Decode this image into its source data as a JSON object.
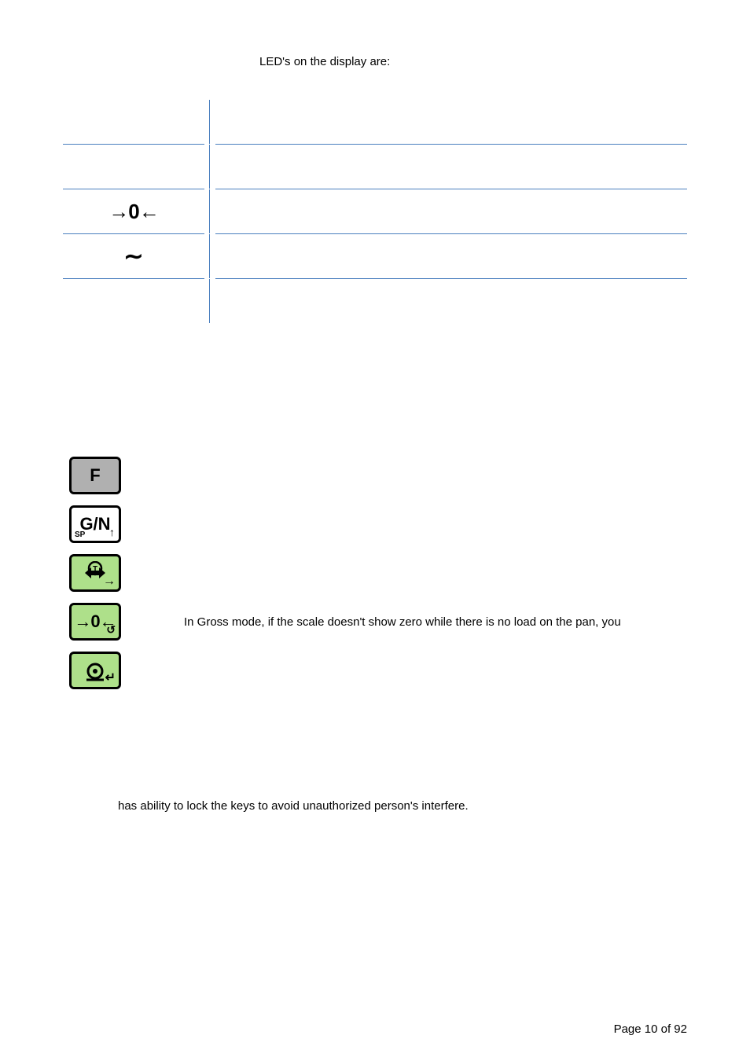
{
  "intro_text": "LED's on the display are:",
  "table": {
    "rows": [
      {
        "symbol_name": "blank-1",
        "symbol_glyph": ""
      },
      {
        "symbol_name": "blank-2",
        "symbol_glyph": ""
      },
      {
        "symbol_name": "zero-indicator",
        "symbol_glyph": "→0←"
      },
      {
        "symbol_name": "motion-indicator",
        "symbol_glyph": "∼"
      },
      {
        "symbol_name": "blank-3",
        "symbol_glyph": ""
      }
    ]
  },
  "keys": {
    "f": {
      "label": "F"
    },
    "gn": {
      "label": "G/N",
      "sp": "SP",
      "arrow": "↑"
    },
    "tare": {
      "t_glyph": "T",
      "arrow": "→"
    },
    "zero": {
      "glyph": "→0←",
      "loop": "↺"
    },
    "power": {
      "glyph": "⏻",
      "enter": "↵"
    },
    "zero_desc": "In Gross mode, if the scale doesn't show zero while there is no load on the pan, you"
  },
  "lock_text": "has ability to lock the keys to avoid unauthorized person's interfere.",
  "page_label": "Page 10 of 92"
}
